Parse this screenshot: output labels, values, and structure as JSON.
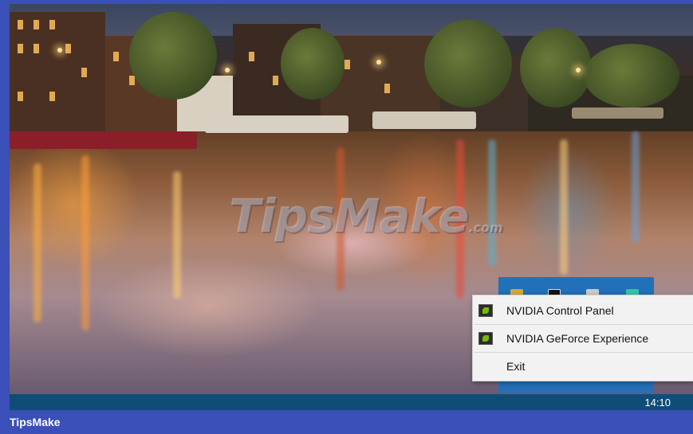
{
  "watermark": {
    "text": "TipsMake",
    "suffix": ".com"
  },
  "taskbar": {
    "clock": "14:10"
  },
  "tray": {
    "icons": [
      "app-icon",
      "terminal-icon",
      "folder-icon",
      "network-icon"
    ]
  },
  "context_menu": {
    "items": [
      {
        "label": "NVIDIA Control Panel",
        "icon": "nvidia-icon"
      },
      {
        "label": "NVIDIA GeForce Experience",
        "icon": "nvidia-icon"
      },
      {
        "label": "Exit"
      }
    ]
  },
  "footer": {
    "brand": "TipsMake"
  },
  "colors": {
    "frame": "#3a4fb8",
    "taskbar": "#0f4d78",
    "tray": "#2270b8",
    "menu": "#f2f2f2",
    "nvidia": "#76b900"
  }
}
